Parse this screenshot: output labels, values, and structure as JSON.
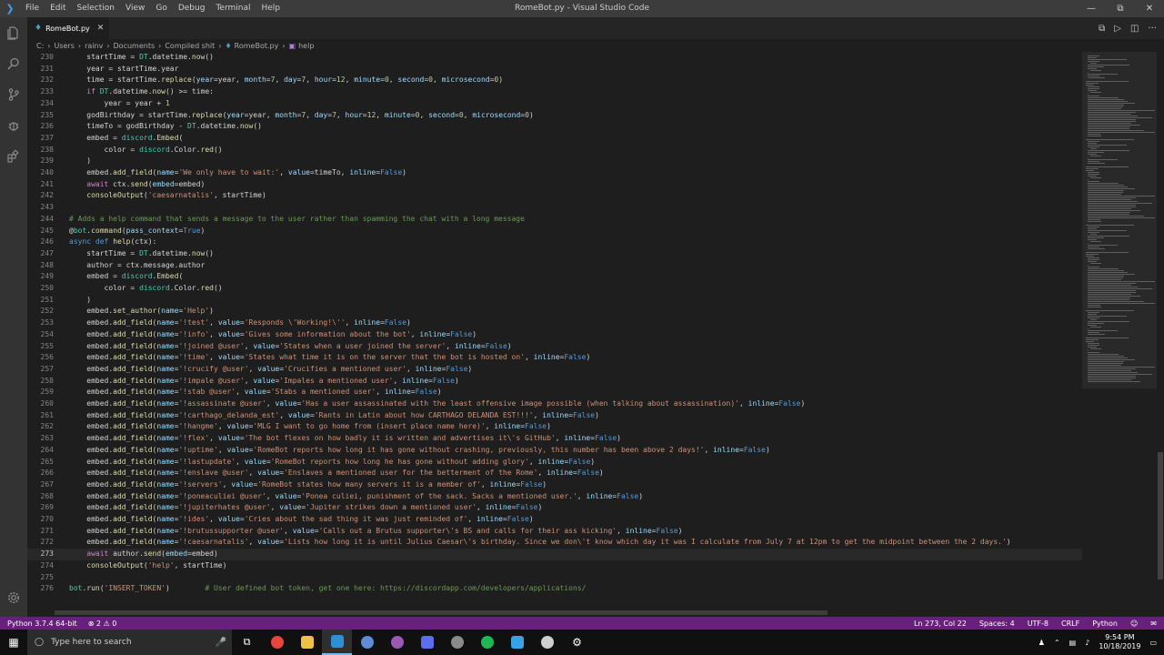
{
  "window": {
    "title": "RomeBot.py - Visual Studio Code",
    "menu": [
      "File",
      "Edit",
      "Selection",
      "View",
      "Go",
      "Debug",
      "Terminal",
      "Help"
    ]
  },
  "tab": {
    "label": "RomeBot.py"
  },
  "breadcrumb": [
    "C:",
    "Users",
    "rainv",
    "Documents",
    "Compiled shit",
    "RomeBot.py",
    "help"
  ],
  "editor": {
    "current_line": 273,
    "lines": [
      {
        "n": 230,
        "text": "    startTime = DT.datetime.now()"
      },
      {
        "n": 231,
        "text": "    year = startTime.year"
      },
      {
        "n": 232,
        "text": "    time = startTime.replace(year=year, month=7, day=7, hour=12, minute=0, second=0, microsecond=0)"
      },
      {
        "n": 233,
        "text": "    if DT.datetime.now() >= time:"
      },
      {
        "n": 234,
        "text": "        year = year + 1"
      },
      {
        "n": 235,
        "text": "    godBirthday = startTime.replace(year=year, month=7, day=7, hour=12, minute=0, second=0, microsecond=0)"
      },
      {
        "n": 236,
        "text": "    timeTo = godBirthday - DT.datetime.now()"
      },
      {
        "n": 237,
        "text": "    embed = discord.Embed("
      },
      {
        "n": 238,
        "text": "        color = discord.Color.red()"
      },
      {
        "n": 239,
        "text": "    )"
      },
      {
        "n": 240,
        "text": "    embed.add_field(name='We only have to wait:', value=timeTo, inline=False)"
      },
      {
        "n": 241,
        "text": "    await ctx.send(embed=embed)"
      },
      {
        "n": 242,
        "text": "    consoleOutput('caesarnatalis', startTime)"
      },
      {
        "n": 243,
        "text": ""
      },
      {
        "n": 244,
        "text": "# Adds a help command that sends a message to the user rather than spamming the chat with a long message"
      },
      {
        "n": 245,
        "text": "@bot.command(pass_context=True)"
      },
      {
        "n": 246,
        "text": "async def help(ctx):"
      },
      {
        "n": 247,
        "text": "    startTime = DT.datetime.now()"
      },
      {
        "n": 248,
        "text": "    author = ctx.message.author"
      },
      {
        "n": 249,
        "text": "    embed = discord.Embed("
      },
      {
        "n": 250,
        "text": "        color = discord.Color.red()"
      },
      {
        "n": 251,
        "text": "    )"
      },
      {
        "n": 252,
        "text": "    embed.set_author(name='Help')"
      },
      {
        "n": 253,
        "text": "    embed.add_field(name='!test', value='Responds \\'Working!\\'', inline=False)"
      },
      {
        "n": 254,
        "text": "    embed.add_field(name='!info', value='Gives some information about the bot', inline=False)"
      },
      {
        "n": 255,
        "text": "    embed.add_field(name='!joined @user', value='States when a user joined the server', inline=False)"
      },
      {
        "n": 256,
        "text": "    embed.add_field(name='!time', value='States what time it is on the server that the bot is hosted on', inline=False)"
      },
      {
        "n": 257,
        "text": "    embed.add_field(name='!crucify @user', value='Crucifies a mentioned user', inline=False)"
      },
      {
        "n": 258,
        "text": "    embed.add_field(name='!impale @user', value='Impales a mentioned user', inline=False)"
      },
      {
        "n": 259,
        "text": "    embed.add_field(name='!stab @user', value='Stabs a mentioned user', inline=False)"
      },
      {
        "n": 260,
        "text": "    embed.add_field(name='!assassinate @user', value='Has a user assassinated with the least offensive image possible (when talking about assassination)', inline=False)"
      },
      {
        "n": 261,
        "text": "    embed.add_field(name='!carthago_delanda_est', value='Rants in Latin about how CARTHAGO DELANDA EST!!!', inline=False)"
      },
      {
        "n": 262,
        "text": "    embed.add_field(name='!hangme', value='MLG I want to go home from (insert place name here)', inline=False)"
      },
      {
        "n": 263,
        "text": "    embed.add_field(name='!flex', value='The bot flexes on how badly it is written and advertises it\\'s GitHub', inline=False)"
      },
      {
        "n": 264,
        "text": "    embed.add_field(name='!uptime', value='RomeBot reports how long it has gone without crashing, previously, this number has been above 2 days!', inline=False)"
      },
      {
        "n": 265,
        "text": "    embed.add_field(name='!lastupdate', value='RomeBot reports how long he has gone without adding glory', inline=False)"
      },
      {
        "n": 266,
        "text": "    embed.add_field(name='!enslave @user', value='Enslaves a mentioned user for the betterment of the Rome', inline=False)"
      },
      {
        "n": 267,
        "text": "    embed.add_field(name='!servers', value='RomeBot states how many servers it is a member of', inline=False)"
      },
      {
        "n": 268,
        "text": "    embed.add_field(name='!poneaculiei @user', value='Ponea culiei, punishment of the sack. Sacks a mentioned user.', inline=False)"
      },
      {
        "n": 269,
        "text": "    embed.add_field(name='!jupiterhates @user', value='Jupiter strikes down a mentioned user', inline=False)"
      },
      {
        "n": 270,
        "text": "    embed.add_field(name='!ides', value='Cries about the sad thing it was just reminded of', inline=False)"
      },
      {
        "n": 271,
        "text": "    embed.add_field(name='!brutussupporter @user', value='Calls out a Brutus supporter\\'s BS and calls for their ass kicking', inline=False)"
      },
      {
        "n": 272,
        "text": "    embed.add_field(name='!caesarnatalis', value='Lists how long it is until Julius Caesar\\'s birthday. Since we don\\'t know which day it was I calculate from July 7 at 12pm to get the midpoint between the 2 days.')"
      },
      {
        "n": 273,
        "text": "    await author.send(embed=embed)"
      },
      {
        "n": 274,
        "text": "    consoleOutput('help', startTime)"
      },
      {
        "n": 275,
        "text": ""
      },
      {
        "n": 276,
        "text": "bot.run('INSERT_TOKEN')        # User defined bot token, get one here: https://discordapp.com/developers/applications/"
      }
    ]
  },
  "statusbar": {
    "python": "Python 3.7.4 64-bit",
    "problems": "⊗ 2 ⚠ 0",
    "position": "Ln 273, Col 22",
    "spaces": "Spaces: 4",
    "encoding": "UTF-8",
    "eol": "CRLF",
    "language": "Python"
  },
  "taskbar": {
    "search_placeholder": "Type here to search",
    "time": "9:54 PM",
    "date": "10/18/2019"
  },
  "colors": {
    "statusbar": "#68217a",
    "editor_bg": "#1e1e1e",
    "activitybar": "#333333"
  }
}
